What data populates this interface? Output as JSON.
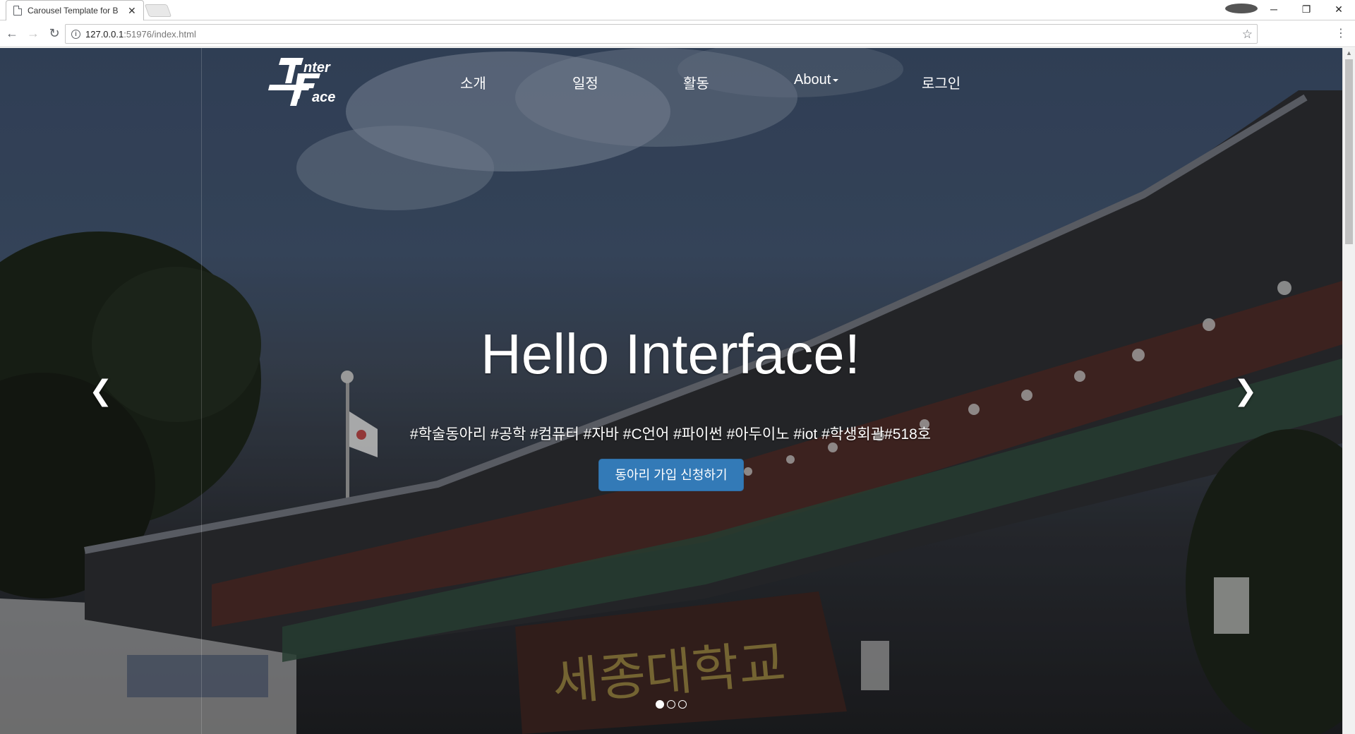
{
  "browser": {
    "tab_title": "Carousel Template for B",
    "url_host": "127.0.0.1",
    "url_rest": ":51976/index.html"
  },
  "navbar": {
    "logo_line1": "nter",
    "logo_line2": "ace",
    "items": [
      {
        "label": "소개"
      },
      {
        "label": "일정"
      },
      {
        "label": "활동"
      },
      {
        "label": "About"
      },
      {
        "label": "로그인"
      }
    ]
  },
  "carousel": {
    "headline": "Hello Interface!",
    "tags": "#학술동아리 #공학 #컴퓨터 #자바 #C언어 #파이썬 #아두이노 #iot #학생회관#518호",
    "cta_label": "동아리 가입 신청하기",
    "signboard_text": "세종대학교",
    "prev_icon": "chevron-left-icon",
    "next_icon": "chevron-right-icon",
    "slide_count": 3,
    "active_slide": 1
  },
  "colors": {
    "primary_button": "#337ab7",
    "text": "#ffffff"
  }
}
